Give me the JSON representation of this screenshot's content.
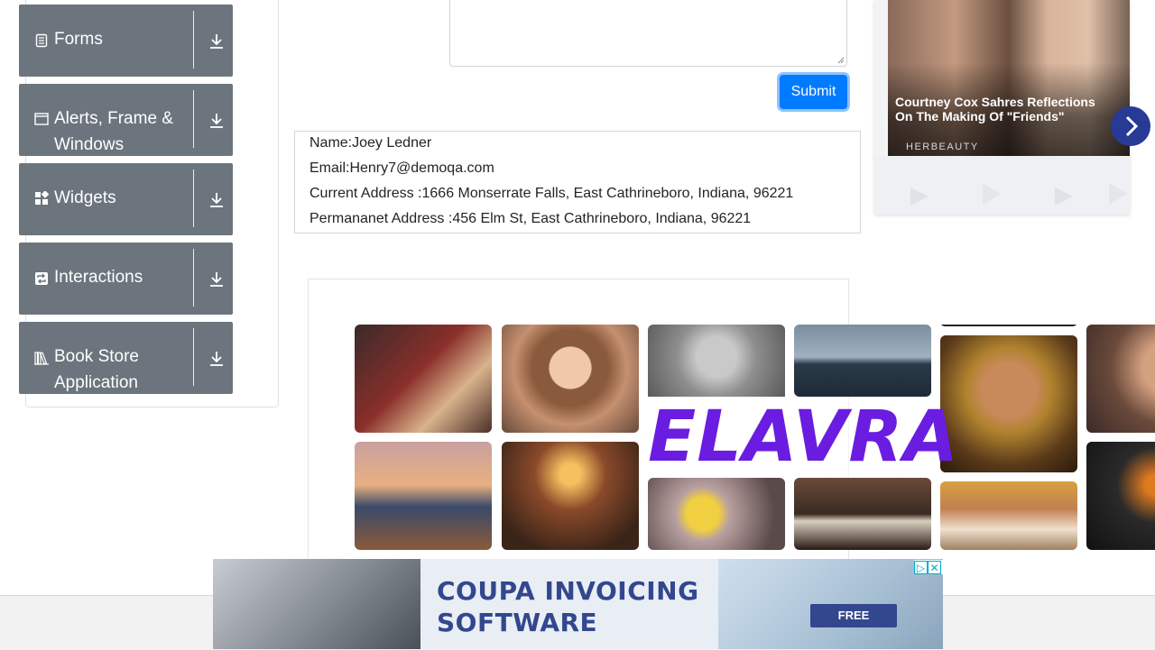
{
  "sidebar": {
    "groups": [
      {
        "label": "Forms",
        "icon": "document-icon"
      },
      {
        "label": "Alerts, Frame & Windows",
        "icon": "window-icon"
      },
      {
        "label": "Widgets",
        "icon": "widgets-icon"
      },
      {
        "label": "Interactions",
        "icon": "interactions-icon"
      },
      {
        "label": "Book Store Application",
        "icon": "books-icon"
      }
    ]
  },
  "form": {
    "submit_label": "Submit"
  },
  "output": {
    "name": "Name:Joey Ledner",
    "email": "Email:Henry7@demoqa.com",
    "current_address": "Current Address :1666 Monserrate Falls, East Cathrineboro, Indiana, 96221",
    "permanent_address": "Permananet Address :456 Elm St, East Cathrineboro, Indiana, 96221"
  },
  "ads": {
    "right": {
      "headline": "Courtney Cox Sahres Reflections On The Making Of \"Friends\"",
      "source": "HERBEAUTY"
    },
    "image_grid": {
      "brand": "ELAVRA"
    },
    "banner": {
      "line1": "COUPA INVOICING",
      "line2": "SOFTWARE",
      "cta": "FREE"
    }
  },
  "colors": {
    "sidebar_group": "#6c757d",
    "primary": "#007bff",
    "elavra_purple": "#6a1de0",
    "coupa_blue": "#33478e"
  }
}
